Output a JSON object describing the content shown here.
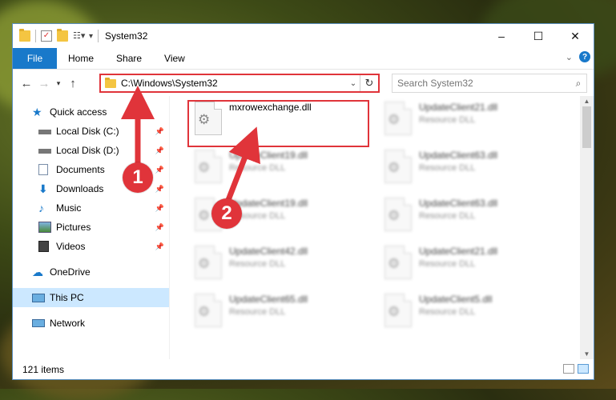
{
  "window": {
    "title": "System32",
    "controls": {
      "minimize": "–",
      "maximize": "☐",
      "close": "✕"
    }
  },
  "ribbon": {
    "tabs": [
      "File",
      "Home",
      "Share",
      "View"
    ],
    "expand_icon": "chevron-down-icon",
    "help_label": "?"
  },
  "address": {
    "path": "C:\\Windows\\System32",
    "search_placeholder": "Search System32"
  },
  "nav": {
    "items": [
      {
        "label": "Quick access",
        "icon": "star-icon",
        "pinned": false
      },
      {
        "label": "Local Disk (C:)",
        "icon": "drive-icon",
        "pinned": true
      },
      {
        "label": "Local Disk (D:)",
        "icon": "drive-icon",
        "pinned": true
      },
      {
        "label": "Documents",
        "icon": "documents-icon",
        "pinned": true
      },
      {
        "label": "Downloads",
        "icon": "download-icon",
        "pinned": true
      },
      {
        "label": "Music",
        "icon": "music-icon",
        "pinned": true
      },
      {
        "label": "Pictures",
        "icon": "pictures-icon",
        "pinned": true
      },
      {
        "label": "Videos",
        "icon": "videos-icon",
        "pinned": true
      },
      {
        "label": "OneDrive",
        "icon": "cloud-icon",
        "pinned": false
      },
      {
        "label": "This PC",
        "icon": "computer-icon",
        "pinned": false
      },
      {
        "label": "Network",
        "icon": "network-icon",
        "pinned": false
      }
    ]
  },
  "files": {
    "highlighted": {
      "name": "mxrowexchange.dll",
      "type": ""
    },
    "blurred": [
      {
        "name": "UpdateClient21.dll",
        "type": "Resource DLL"
      },
      {
        "name": "UpdateClient19.dll",
        "type": "Resource DLL"
      },
      {
        "name": "UpdateClient63.dll",
        "type": "Resource DLL"
      },
      {
        "name": "UpdateClient19.dll",
        "type": "Resource DLL"
      },
      {
        "name": "UpdateClient63.dll",
        "type": "Resource DLL"
      },
      {
        "name": "UpdateClient42.dll",
        "type": "Resource DLL"
      },
      {
        "name": "UpdateClient21.dll",
        "type": "Resource DLL"
      },
      {
        "name": "UpdateClient65.dll",
        "type": "Resource DLL"
      },
      {
        "name": "UpdateClient5.dll",
        "type": "Resource DLL"
      }
    ]
  },
  "status": {
    "item_count": "121 items"
  },
  "annotations": {
    "step1": "1",
    "step2": "2"
  },
  "colors": {
    "accent": "#1979ca",
    "highlight": "#e0343a",
    "selected": "#cce8ff"
  }
}
